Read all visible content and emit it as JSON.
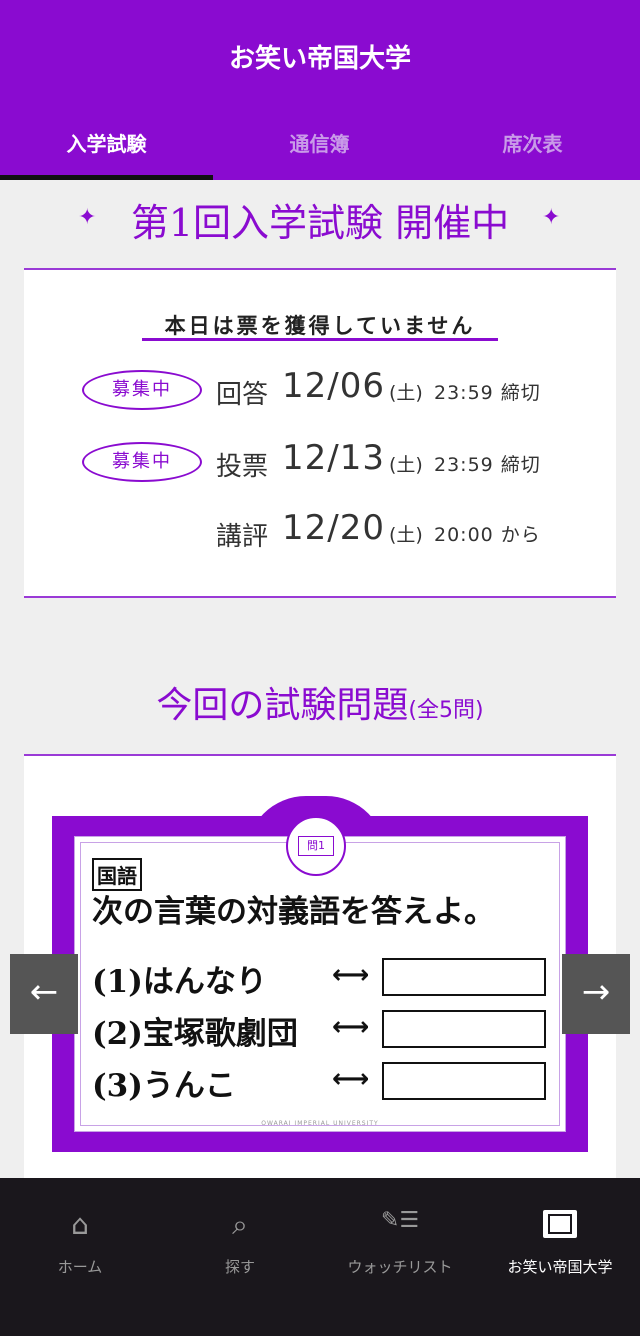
{
  "header": {
    "title": "お笑い帝国大学",
    "tabs": [
      {
        "label": "入学試験",
        "active": true
      },
      {
        "label": "通信簿",
        "active": false
      },
      {
        "label": "席次表",
        "active": false
      }
    ]
  },
  "event": {
    "title": "第1回入学試験 開催中",
    "sparkle_left": "✦",
    "sparkle_right": "✦"
  },
  "info": {
    "ticket_status": "本日は票を獲得していません",
    "rows": [
      {
        "badge": "募集中",
        "label": "回答",
        "date": "12/06",
        "day": "(土)",
        "time": "23:59 締切"
      },
      {
        "badge": "募集中",
        "label": "投票",
        "date": "12/13",
        "day": "(土)",
        "time": "23:59 締切"
      },
      {
        "badge": "",
        "label": "講評",
        "date": "12/20",
        "day": "(土)",
        "time": "20:00 から"
      }
    ]
  },
  "questions_section": {
    "title": "今回の試験問題",
    "count": "(全5問)"
  },
  "question_card": {
    "emblem_label": "問1",
    "subject": "国語",
    "prompt": "次の言葉の対義語を答えよ。",
    "items": [
      {
        "text": "(1)はんなり",
        "arrow": "⟷"
      },
      {
        "text": "(2)宝塚歌劇団",
        "arrow": "⟷"
      },
      {
        "text": "(3)うんこ",
        "arrow": "⟷"
      }
    ],
    "footer": "OWARAI IMPERIAL UNIVERSITY"
  },
  "carousel": {
    "prev": "←",
    "next": "→"
  },
  "bottom_nav": [
    {
      "icon": "home-icon",
      "glyph": "⌂",
      "label": "ホーム"
    },
    {
      "icon": "search-icon",
      "glyph": "⌕",
      "label": "探す"
    },
    {
      "icon": "watchlist-icon",
      "glyph": "✎☰",
      "label": "ウォッチリスト"
    },
    {
      "icon": "university-icon",
      "glyph": "",
      "label": "お笑い帝国大学",
      "active": true
    }
  ],
  "colors": {
    "brand_purple": "#8a0bd0",
    "nav_background": "#1a171c"
  }
}
